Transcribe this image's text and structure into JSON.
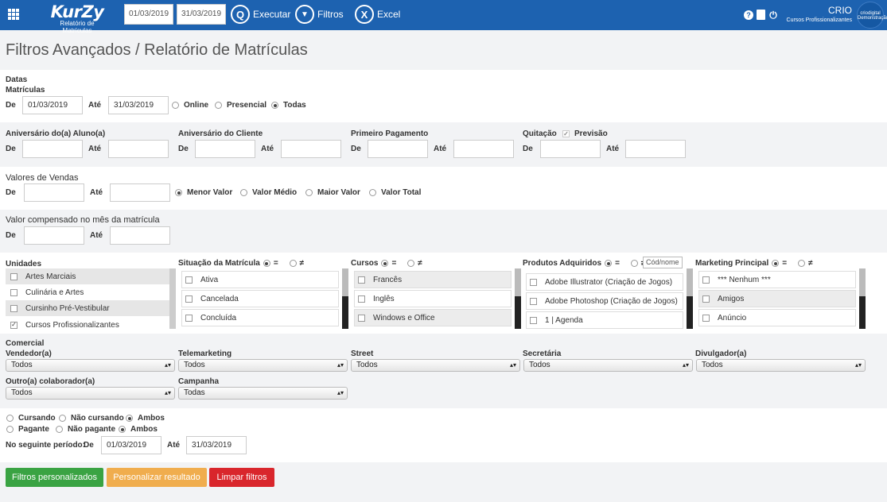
{
  "header": {
    "logo_main": "KurZy",
    "logo_sub": "Relatório de Matrículas",
    "date_from": "01/03/2019",
    "date_to": "31/03/2019",
    "executar": "Executar",
    "filtros": "Filtros",
    "excel": "Excel",
    "user": "CRIO",
    "company": "Cursos Profissionalizantes",
    "avatar_text": "criodigital Demonstração",
    "excel_glyph": "X",
    "filter_glyph": "▼",
    "search_glyph": "Q",
    "help_glyph": "?",
    "power_glyph": "⏻"
  },
  "page_title": "Filtros Avançados / Relatório de Matrículas",
  "datas": {
    "title": "Datas",
    "sub": "Matrículas",
    "de": "De",
    "ate": "Até",
    "from": "01/03/2019",
    "to": "31/03/2019",
    "options": [
      "Online",
      "Presencial",
      "Todas"
    ],
    "selected": "Todas"
  },
  "row2": {
    "aniv_aluno": "Aniversário do(a) Aluno(a)",
    "aniv_cliente": "Aniversário do Cliente",
    "primeiro_pagamento": "Primeiro Pagamento",
    "quitacao": "Quitação",
    "previsao": "Previsão",
    "de": "De",
    "ate": "Até"
  },
  "valores": {
    "title": "Valores de Vendas",
    "de": "De",
    "ate": "Até",
    "options": [
      "Menor Valor",
      "Valor Médio",
      "Maior Valor",
      "Valor Total"
    ],
    "selected": "Menor Valor"
  },
  "compensado": {
    "title": "Valor compensado no mês da matrícula",
    "de": "De",
    "ate": "Até"
  },
  "unidades": {
    "title": "Unidades",
    "items": [
      "Artes Marciais",
      "Culinária e Artes",
      "Cursinho Pré-Vestibular",
      "Cursos Profissionalizantes"
    ],
    "checked": [
      false,
      false,
      false,
      true
    ]
  },
  "situacao": {
    "title": "Situação da Matrícula",
    "eq": "=",
    "neq": "≠",
    "items": [
      "Ativa",
      "Cancelada",
      "Concluída"
    ]
  },
  "cursos": {
    "title": "Cursos",
    "eq": "=",
    "neq": "≠",
    "items": [
      "Francês",
      "Inglês",
      "Windows e Office"
    ]
  },
  "produtos": {
    "title": "Produtos Adquiridos",
    "eq": "=",
    "neq": "≠",
    "cod_placeholder": "Cód/nome",
    "items": [
      "Adobe Illustrator (Criação de Jogos)",
      "Adobe Photoshop (Criação de Jogos)",
      "1 | Agenda"
    ]
  },
  "marketing": {
    "title": "Marketing Principal",
    "eq": "=",
    "neq": "≠",
    "items": [
      "*** Nenhum ***",
      "Amigos",
      "Anúncio"
    ]
  },
  "comercial": {
    "title": "Comercial",
    "fields": [
      {
        "label": "Vendedor(a)",
        "value": "Todos"
      },
      {
        "label": "Telemarketing",
        "value": "Todos"
      },
      {
        "label": "Street",
        "value": "Todos"
      },
      {
        "label": "Secretária",
        "value": "Todos"
      },
      {
        "label": "Divulgador(a)",
        "value": "Todos"
      },
      {
        "label": "Outro(a) colaborador(a)",
        "value": "Todos"
      },
      {
        "label": "Campanha",
        "value": "Todas"
      }
    ]
  },
  "status": {
    "cursando": "Cursando",
    "nao_cursando": "Não cursando",
    "ambos1": "Ambos",
    "pagante": "Pagante",
    "nao_pagante": "Não pagante",
    "ambos2": "Ambos",
    "periodo": "No seguinte período:",
    "de": "De",
    "ate": "Até",
    "from": "01/03/2019",
    "to": "31/03/2019"
  },
  "buttons": {
    "filtros_personalizados": "Filtros personalizados",
    "personalizar": "Personalizar resultado",
    "limpar": "Limpar filtros"
  },
  "colors": {
    "header": "#1d62b0",
    "green": "#3aa343",
    "orange": "#f0ad4e",
    "red": "#d9262c"
  }
}
